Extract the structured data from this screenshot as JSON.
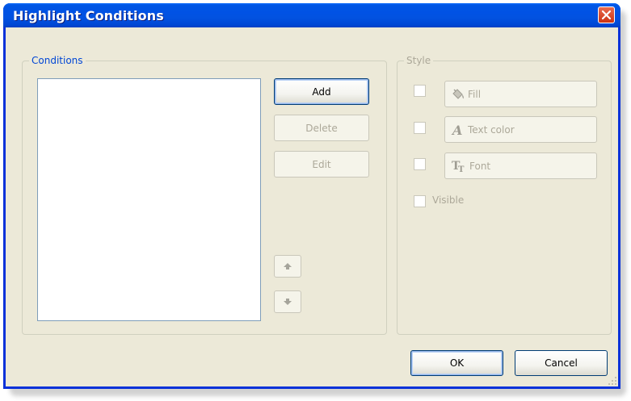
{
  "window": {
    "title": "Highlight Conditions"
  },
  "conditions": {
    "legend": "Conditions",
    "items": [],
    "add_label": "Add",
    "delete_label": "Delete",
    "edit_label": "Edit"
  },
  "style": {
    "legend": "Style",
    "fill_label": "Fill",
    "text_color_label": "Text color",
    "font_label": "Font",
    "visible_label": "Visible",
    "fill_checked": false,
    "text_color_checked": false,
    "font_checked": false,
    "visible_checked": false
  },
  "footer": {
    "ok_label": "OK",
    "cancel_label": "Cancel"
  },
  "icons": {
    "close": "close-icon",
    "fill": "paint-bucket-icon",
    "text_color": "text-color-icon",
    "font": "font-icon",
    "move_up": "arrow-up-icon",
    "move_down": "arrow-down-icon"
  },
  "colors": {
    "titlebar": "#0054e3",
    "dialog_bg": "#ece9d8",
    "legend_text": "#0046d5",
    "disabled_text": "#aca899",
    "close_button": "#d8481f"
  }
}
